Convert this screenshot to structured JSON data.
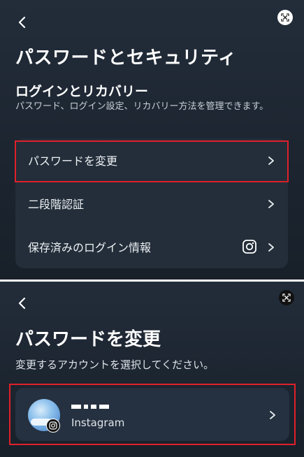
{
  "screen1": {
    "title": "パスワードとセキュリティ",
    "section_title": "ログインとリカバリー",
    "section_description": "パスワード、ログイン設定、リカバリー方法を管理できます。",
    "items": [
      {
        "label": "パスワードを変更"
      },
      {
        "label": "二段階認証"
      },
      {
        "label": "保存済みのログイン情報",
        "icon": "instagram-icon"
      }
    ]
  },
  "screen2": {
    "title": "パスワードを変更",
    "subtitle": "変更するアカウントを選択してください。",
    "account": {
      "platform": "Instagram",
      "badge_icon": "instagram-icon"
    }
  },
  "colors": {
    "highlight": "#e0202a",
    "background": "#1c2530",
    "card": "#232e3a"
  }
}
